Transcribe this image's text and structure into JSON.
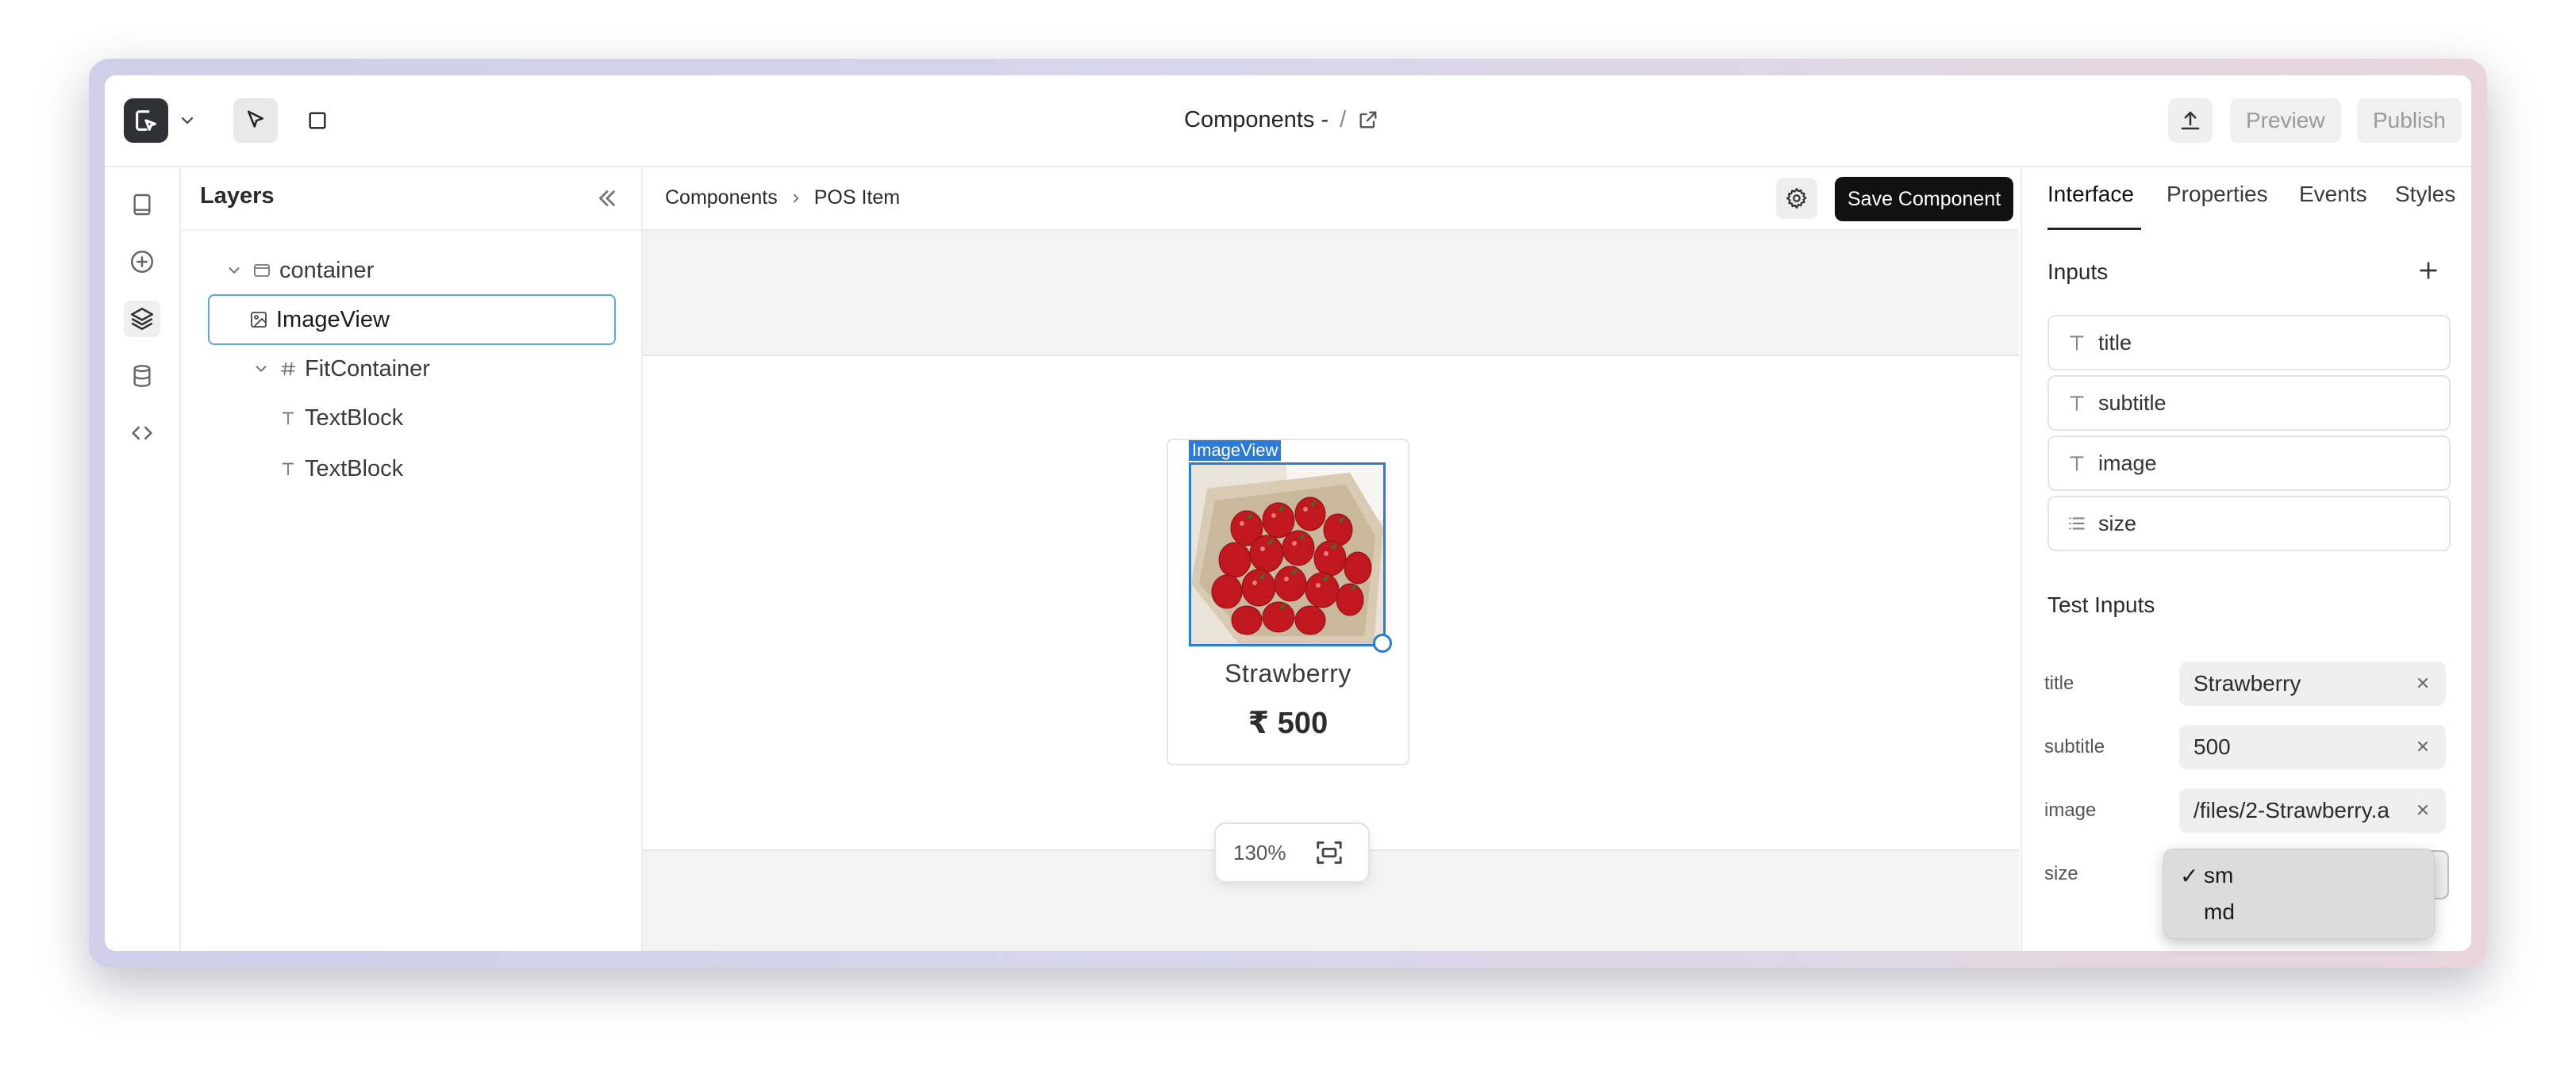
{
  "window": {
    "title_text": "Components -",
    "title_slash": "/"
  },
  "toolbar": {
    "preview_label": "Preview",
    "publish_label": "Publish"
  },
  "layers": {
    "title": "Layers",
    "tree": [
      {
        "label": "container",
        "icon": "container-icon",
        "expanded": true
      },
      {
        "label": "ImageView",
        "icon": "image-icon",
        "selected": true
      },
      {
        "label": "FitContainer",
        "icon": "hash-icon",
        "expanded": true
      },
      {
        "label": "TextBlock",
        "icon": "text-icon"
      },
      {
        "label": "TextBlock",
        "icon": "text-icon"
      }
    ]
  },
  "canvas": {
    "breadcrumb": [
      "Components",
      "POS Item"
    ],
    "save_label": "Save Component",
    "selection_label": "ImageView",
    "card": {
      "title": "Strawberry",
      "price": "₹ 500"
    },
    "zoom": "130%"
  },
  "right_panel": {
    "tabs": [
      "Interface",
      "Properties",
      "Events",
      "Styles"
    ],
    "active_tab": "Interface",
    "inputs_title": "Inputs",
    "inputs": [
      {
        "name": "title",
        "type_icon": "text-type-icon"
      },
      {
        "name": "subtitle",
        "type_icon": "text-type-icon"
      },
      {
        "name": "image",
        "type_icon": "text-type-icon"
      },
      {
        "name": "size",
        "type_icon": "list-type-icon"
      }
    ],
    "test_inputs_title": "Test Inputs",
    "test_inputs": [
      {
        "label": "title",
        "value": "Strawberry"
      },
      {
        "label": "subtitle",
        "value": "500"
      },
      {
        "label": "image",
        "value": "/files/2-Strawberry.a"
      },
      {
        "label": "size",
        "value": "sm"
      }
    ],
    "size_options": [
      {
        "label": "sm",
        "checked": true,
        "check_mark": "✓"
      },
      {
        "label": "md",
        "checked": false,
        "check_mark": ""
      }
    ]
  },
  "colors": {
    "accent": "#2b7bdc",
    "primary_button": "#111111",
    "selected_border": "#5aa9e6"
  }
}
